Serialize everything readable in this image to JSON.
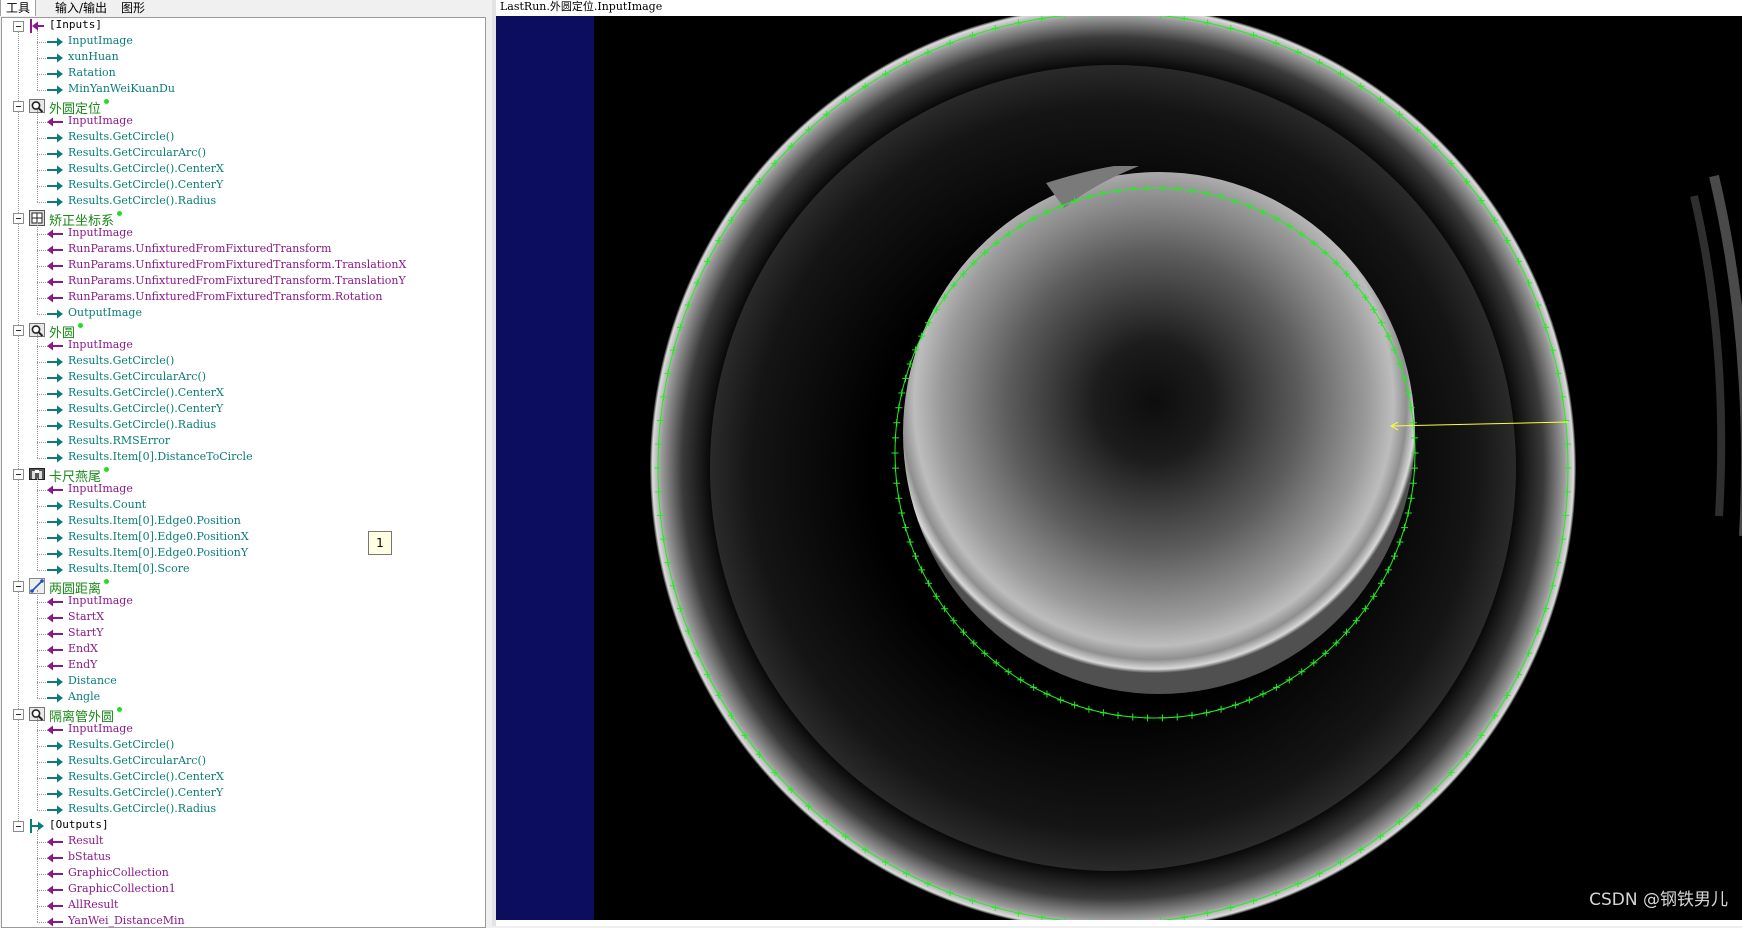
{
  "tabs": [
    {
      "label": "工具",
      "active": true
    },
    {
      "label": "输入/输出",
      "active": false
    },
    {
      "label": "图形",
      "active": false
    }
  ],
  "tree": [
    {
      "kind": "group",
      "label": "[Inputs]",
      "icon": "inputs-icon",
      "children": [
        {
          "label": "InputImage",
          "dir": "out"
        },
        {
          "label": "xunHuan",
          "dir": "out"
        },
        {
          "label": "Ratation",
          "dir": "out"
        },
        {
          "label": "MinYanWeiKuanDu",
          "dir": "out"
        }
      ]
    },
    {
      "kind": "tool",
      "label": "外圆定位",
      "icon": "caliper-search-icon",
      "status": "ok",
      "children": [
        {
          "label": "InputImage",
          "dir": "in"
        },
        {
          "label": "Results.GetCircle()",
          "dir": "out"
        },
        {
          "label": "Results.GetCircularArc()",
          "dir": "out"
        },
        {
          "label": "Results.GetCircle().CenterX",
          "dir": "out"
        },
        {
          "label": "Results.GetCircle().CenterY",
          "dir": "out"
        },
        {
          "label": "Results.GetCircle().Radius",
          "dir": "out"
        }
      ]
    },
    {
      "kind": "tool",
      "label": "矫正坐标系",
      "icon": "fixture-icon",
      "status": "ok",
      "children": [
        {
          "label": "InputImage",
          "dir": "in"
        },
        {
          "label": "RunParams.UnfixturedFromFixturedTransform",
          "dir": "in"
        },
        {
          "label": "RunParams.UnfixturedFromFixturedTransform.TranslationX",
          "dir": "in"
        },
        {
          "label": "RunParams.UnfixturedFromFixturedTransform.TranslationY",
          "dir": "in"
        },
        {
          "label": "RunParams.UnfixturedFromFixturedTransform.Rotation",
          "dir": "in"
        },
        {
          "label": "OutputImage",
          "dir": "out"
        }
      ]
    },
    {
      "kind": "tool",
      "label": "外圆",
      "icon": "caliper-search-icon",
      "status": "ok",
      "children": [
        {
          "label": "InputImage",
          "dir": "in"
        },
        {
          "label": "Results.GetCircle()",
          "dir": "out"
        },
        {
          "label": "Results.GetCircularArc()",
          "dir": "out"
        },
        {
          "label": "Results.GetCircle().CenterX",
          "dir": "out"
        },
        {
          "label": "Results.GetCircle().CenterY",
          "dir": "out"
        },
        {
          "label": "Results.GetCircle().Radius",
          "dir": "out"
        },
        {
          "label": "Results.RMSError",
          "dir": "out"
        },
        {
          "label": "Results.Item[0].DistanceToCircle",
          "dir": "out"
        }
      ]
    },
    {
      "kind": "tool",
      "label": "卡尺燕尾",
      "icon": "caliper-icon",
      "status": "ok",
      "children": [
        {
          "label": "InputImage",
          "dir": "in"
        },
        {
          "label": "Results.Count",
          "dir": "out"
        },
        {
          "label": "Results.Item[0].Edge0.Position",
          "dir": "out"
        },
        {
          "label": "Results.Item[0].Edge0.PositionX",
          "dir": "out"
        },
        {
          "label": "Results.Item[0].Edge0.PositionY",
          "dir": "out"
        },
        {
          "label": "Results.Item[0].Score",
          "dir": "out"
        }
      ]
    },
    {
      "kind": "tool",
      "label": "两圆距离",
      "icon": "distance-icon",
      "status": "ok",
      "children": [
        {
          "label": "InputImage",
          "dir": "in"
        },
        {
          "label": "StartX",
          "dir": "in"
        },
        {
          "label": "StartY",
          "dir": "in"
        },
        {
          "label": "EndX",
          "dir": "in"
        },
        {
          "label": "EndY",
          "dir": "in"
        },
        {
          "label": "Distance",
          "dir": "out"
        },
        {
          "label": "Angle",
          "dir": "out"
        }
      ]
    },
    {
      "kind": "tool",
      "label": "隔离管外圆",
      "icon": "caliper-search-icon",
      "status": "ok",
      "children": [
        {
          "label": "InputImage",
          "dir": "in"
        },
        {
          "label": "Results.GetCircle()",
          "dir": "out"
        },
        {
          "label": "Results.GetCircularArc()",
          "dir": "out"
        },
        {
          "label": "Results.GetCircle().CenterX",
          "dir": "out"
        },
        {
          "label": "Results.GetCircle().CenterY",
          "dir": "out"
        },
        {
          "label": "Results.GetCircle().Radius",
          "dir": "out"
        }
      ]
    },
    {
      "kind": "group",
      "label": "[Outputs]",
      "icon": "outputs-icon",
      "children": [
        {
          "label": "Result",
          "dir": "in"
        },
        {
          "label": "bStatus",
          "dir": "in"
        },
        {
          "label": "GraphicCollection",
          "dir": "in"
        },
        {
          "label": "GraphicCollection1",
          "dir": "in"
        },
        {
          "label": "AllResult",
          "dir": "in"
        },
        {
          "label": "YanWei_DistanceMin",
          "dir": "in"
        }
      ]
    }
  ],
  "tooltip": "1",
  "display": {
    "title": "LastRun.外圆定位.InputImage",
    "watermark": "CSDN @钢铁男儿"
  },
  "colors": {
    "tool_label": "#1a8a1a",
    "input_terminal": "#8a1a8a",
    "output_terminal": "#0b7b7b",
    "graphics_green": "#22ee22",
    "graphics_yellow": "#ffff33",
    "display_margin": "#0d0d60"
  }
}
